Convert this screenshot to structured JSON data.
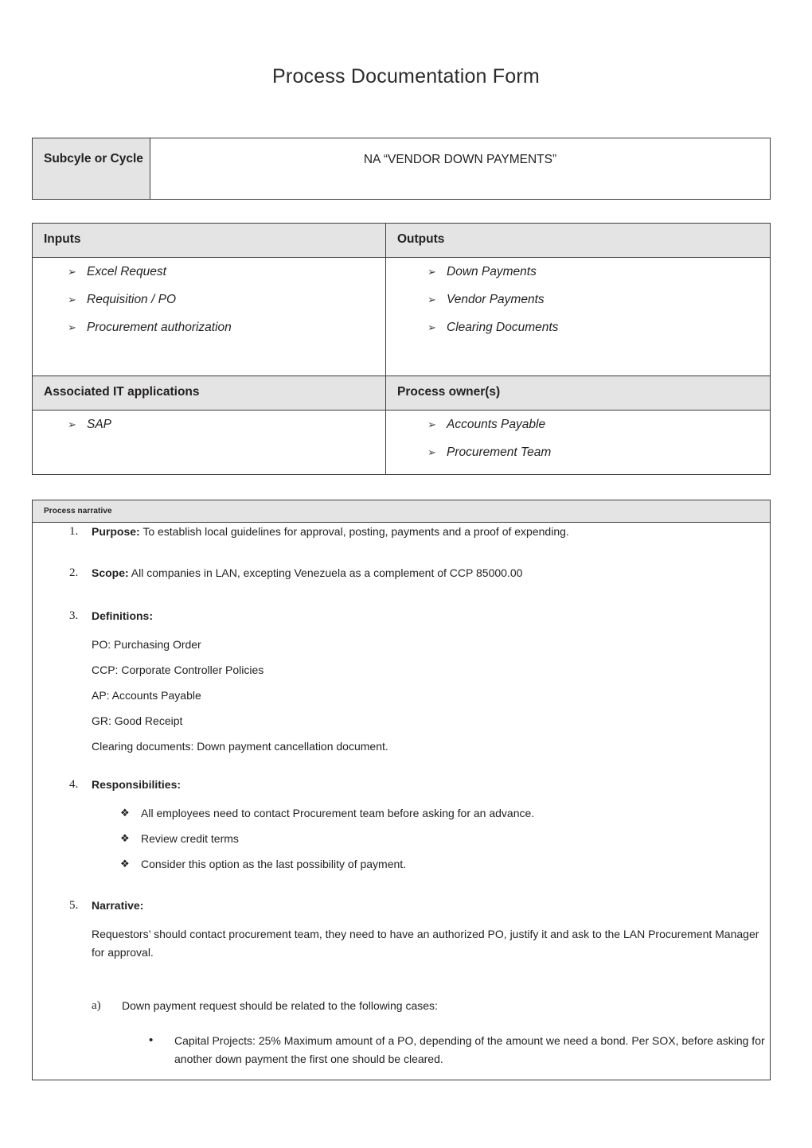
{
  "document": {
    "title": "Process Documentation Form"
  },
  "subcycle": {
    "label": "Subcyle or Cycle",
    "value": "NA “VENDOR DOWN PAYMENTS”"
  },
  "io_table": {
    "inputs_header": "Inputs",
    "outputs_header": "Outputs",
    "inputs": [
      "Excel Request",
      "Requisition / PO",
      "Procurement authorization"
    ],
    "outputs": [
      "Down Payments",
      "Vendor Payments",
      "Clearing Documents"
    ],
    "apps_header": "Associated IT applications",
    "owners_header": "Process owner(s)",
    "apps": [
      "SAP"
    ],
    "owners": [
      "Accounts Payable",
      "Procurement Team"
    ]
  },
  "narrative": {
    "header": "Process narrative",
    "items": [
      {
        "number": "1.",
        "title": "Purpose:",
        "text": "  To establish local guidelines for approval, posting, payments and a proof of expending."
      },
      {
        "number": "2.",
        "title": " Scope:",
        "text": " All companies in  LAN, excepting Venezuela as a complement of CCP 85000.00"
      },
      {
        "number": "3.",
        "title": "Definitions:",
        "text": ""
      },
      {
        "number": "4.",
        "title": "Responsibilities:",
        "text": ""
      },
      {
        "number": "5.",
        "title": "Narrative:",
        "text": ""
      }
    ],
    "definitions": [
      "PO: Purchasing Order",
      "CCP: Corporate Controller Policies",
      "AP: Accounts Payable",
      "GR: Good Receipt",
      "Clearing documents: Down payment cancellation document."
    ],
    "responsibilities": [
      "All employees need to contact Procurement team before asking for an advance.",
      "Review credit terms",
      "Consider this option as the last possibility of payment."
    ],
    "narrative_paragraph": "Requestors’ should contact procurement team, they need to have an authorized PO, justify it and ask to the LAN Procurement Manager for approval.",
    "alpha_item": {
      "marker": "a)",
      "text": "Down payment request should be related to the following cases:"
    },
    "cases": [
      "Capital Projects:  25% Maximum amount of a PO, depending of the amount we need a bond. Per SOX, before asking for another down payment the first one should be cleared."
    ]
  },
  "icons": {
    "arrow_bullet": "➢",
    "diamond_bullet": "❖",
    "dot_bullet": "•"
  },
  "colors": {
    "header_shade": "#e4e4e4",
    "border": "#3c3c3c",
    "text": "#231f20"
  }
}
